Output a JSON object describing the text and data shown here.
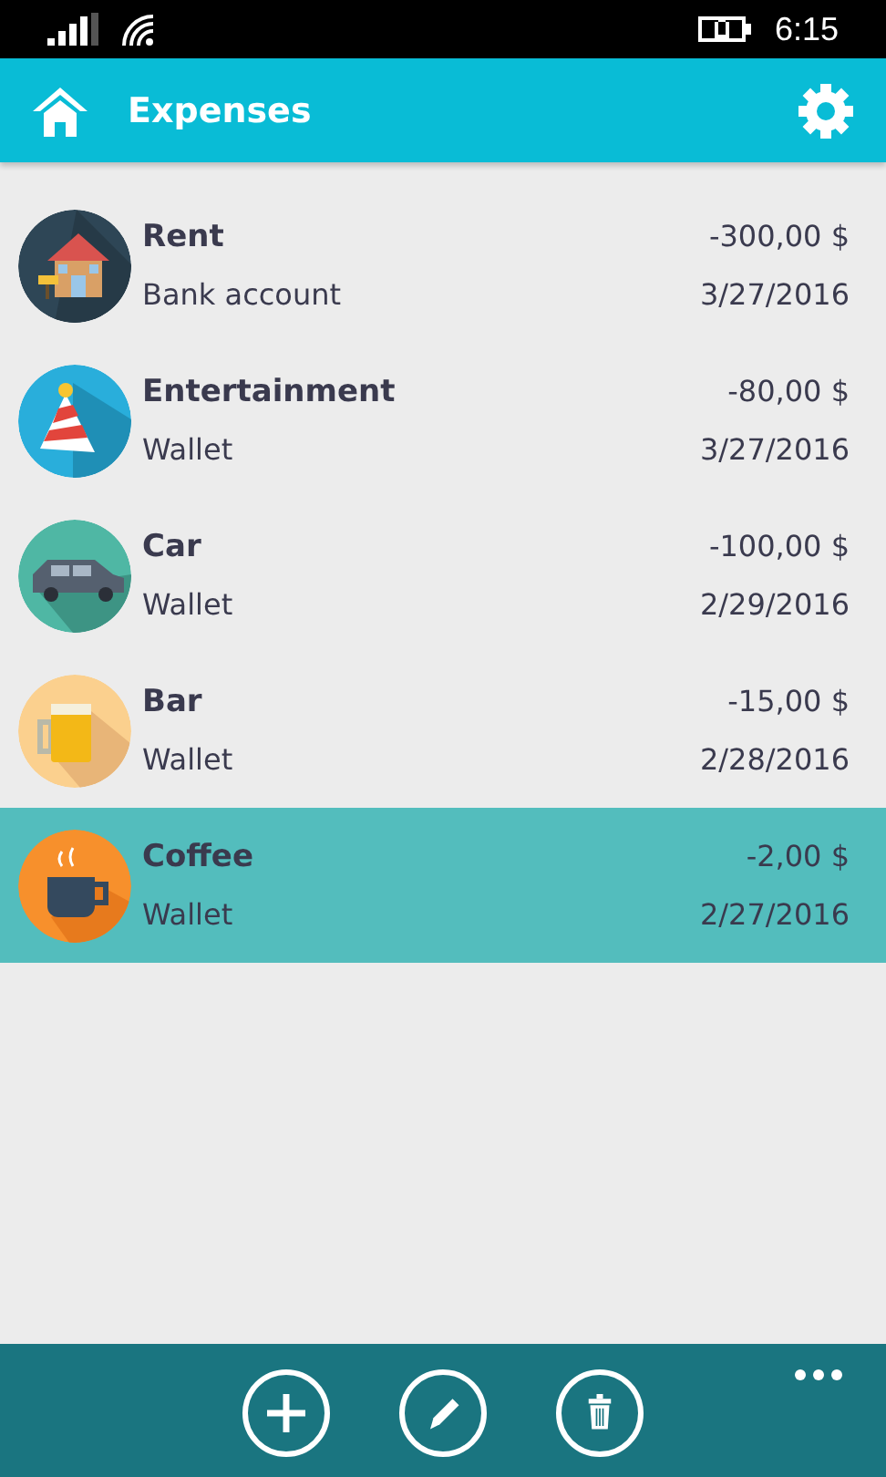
{
  "status_bar": {
    "time": "6:15"
  },
  "header": {
    "title": "Expenses"
  },
  "expenses": [
    {
      "kind": "house",
      "name": "Rent",
      "amount": "-300,00 $",
      "account": "Bank account",
      "date": "3/27/2016",
      "selected": false
    },
    {
      "kind": "party",
      "name": "Entertainment",
      "amount": "-80,00 $",
      "account": "Wallet",
      "date": "3/27/2016",
      "selected": false
    },
    {
      "kind": "car",
      "name": "Car",
      "amount": "-100,00 $",
      "account": "Wallet",
      "date": "2/29/2016",
      "selected": false
    },
    {
      "kind": "beer",
      "name": "Bar",
      "amount": "-15,00 $",
      "account": "Wallet",
      "date": "2/28/2016",
      "selected": false
    },
    {
      "kind": "coffee",
      "name": "Coffee",
      "amount": "-2,00 $",
      "account": "Wallet",
      "date": "2/27/2016",
      "selected": true
    }
  ],
  "app_bar": {
    "buttons": [
      {
        "kind": "add"
      },
      {
        "kind": "edit"
      },
      {
        "kind": "delete"
      }
    ]
  }
}
